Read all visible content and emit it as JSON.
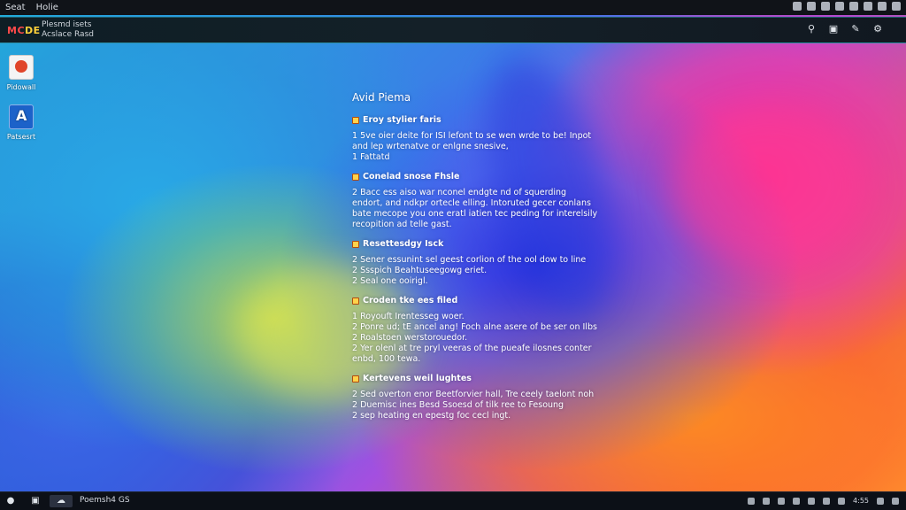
{
  "menubar": {
    "items": [
      "Seat",
      "Holie"
    ]
  },
  "appbar": {
    "logo_part1": "MC",
    "logo_part2": "DE",
    "title_line1": "Plesmd isets",
    "title_line2": "Acslace Rasd"
  },
  "desktop_icons": [
    {
      "label": "Pidowall",
      "icon": "presentation-icon"
    },
    {
      "label": "Patsesrt",
      "icon": "text-editor-icon"
    }
  ],
  "document": {
    "title": "Avid Piema",
    "sections": [
      {
        "heading": "Eroy stylier faris",
        "lines": [
          "1  5ve oier deite for ISI lefont to se wen wrde to be! Inpot",
          "and lep wrtenatve or enlgne snesive,",
          "1  Fattatd"
        ]
      },
      {
        "heading": "Conelad snose Fhsle",
        "lines": [
          "2  Bacc ess aiso war nconel endgte nd of squerding",
          "endort, and ndkpr ortecle elling. Intoruted gecer conlans",
          "bate mecope you one eratl iatien tec peding for interelsily",
          "recopition ad telle gast."
        ]
      },
      {
        "heading": "Resettesdgy Isck",
        "lines": [
          "2  Sener essunint sel geest corlion of the ool dow to line",
          "2  Ssspich Beahtuseegowg eriet.",
          "2  Seal one ooirigl."
        ]
      },
      {
        "heading": "Croden tke ees filed",
        "lines": [
          "1  Royouft Irentesseg woer.",
          "2  Ponre ud; tE ancel ang! Foch alne asere of be ser on Ilbs",
          "2  Roalstoen werstorouedor.",
          "2  Yer olenl at tre pryl veeras of the pueafe ilosnes conter",
          "enbd, 100 tewa."
        ]
      },
      {
        "heading": "Kertevens weil lughtes",
        "lines": [
          "2  Sed overton enor Beetforvier hall, Tre ceely taelont noh",
          "2  Duemisc ines Besd Ssoesd of tilk ree to Fesoung",
          "2  sep heating en epestg foc cecl ingt."
        ]
      }
    ]
  },
  "taskbar": {
    "label": "Poemsh4 GS",
    "time": "4:55"
  },
  "colors": {
    "accent_border": "#2b8fa6",
    "logo_red": "#ff4a4a",
    "logo_yellow": "#ffd23a"
  }
}
